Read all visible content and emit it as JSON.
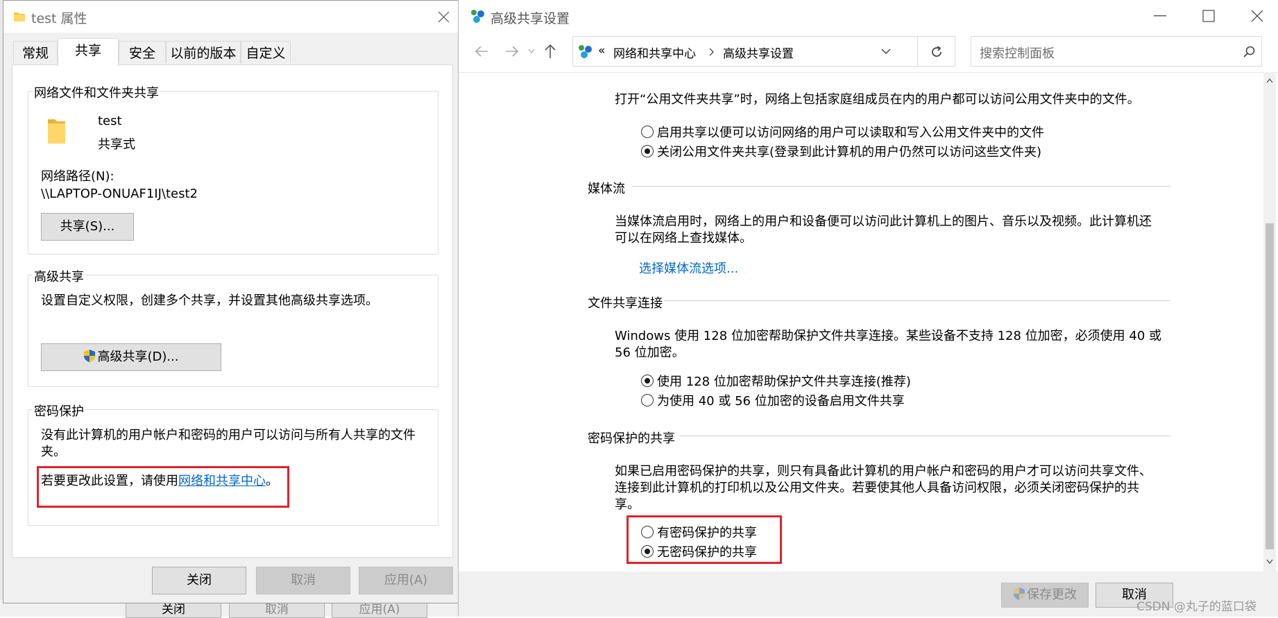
{
  "props": {
    "title": "test 属性",
    "tabs": [
      "常规",
      "共享",
      "安全",
      "以前的版本",
      "自定义"
    ],
    "group1": {
      "title": "网络文件和文件夹共享",
      "folder_name": "test",
      "share_state": "共享式",
      "path_label": "网络路径(N):",
      "path_value": "\\\\LAPTOP-ONUAF1IJ\\test2",
      "share_button": "共享(S)..."
    },
    "group2": {
      "title": "高级共享",
      "desc": "设置自定义权限，创建多个共享，并设置其他高级共享选项。",
      "button": "高级共享(D)..."
    },
    "group3": {
      "title": "密码保护",
      "desc_line1": "没有此计算机的用户帐户和密码的用户可以访问与所有人共享的文件",
      "desc_line2": "夹。",
      "change_prefix": "若要更改此设置，请使用",
      "change_link": "网络和共享中心",
      "change_suffix": "。"
    },
    "buttons": {
      "close": "关闭",
      "cancel": "取消",
      "apply": "应用(A)"
    }
  },
  "background_buttons": {
    "close": "关闭",
    "cancel": "取消",
    "apply": "应用(A)"
  },
  "window": {
    "title": "高级共享设置",
    "breadcrumb_prefix": "«",
    "breadcrumb": [
      "网络和共享中心",
      "高级共享设置"
    ],
    "search_placeholder": "搜索控制面板",
    "public": {
      "desc": "打开“公用文件夹共享”时，网络上包括家庭组成员在内的用户都可以访问公用文件夹中的文件。",
      "opt1": "启用共享以便可以访问网络的用户可以读取和写入公用文件夹中的文件",
      "opt2": "关闭公用文件夹共享(登录到此计算机的用户仍然可以访问这些文件夹)"
    },
    "media": {
      "heading": "媒体流",
      "desc_line1": "当媒体流启用时，网络上的用户和设备便可以访问此计算机上的图片、音乐以及视频。此计算机还",
      "desc_line2": "可以在网络上查找媒体。",
      "link": "选择媒体流选项..."
    },
    "file_sharing": {
      "heading": "文件共享连接",
      "desc_line1": "Windows 使用 128 位加密帮助保护文件共享连接。某些设备不支持 128 位加密，必须使用 40 或",
      "desc_line2": "56 位加密。",
      "opt1": "使用 128 位加密帮助保护文件共享连接(推荐)",
      "opt2": "为使用 40 或 56 位加密的设备启用文件共享"
    },
    "password": {
      "heading": "密码保护的共享",
      "desc_line1": "如果已启用密码保护的共享，则只有具备此计算机的用户帐户和密码的用户才可以访问共享文件、",
      "desc_line2": "连接到此计算机的打印机以及公用文件夹。若要使其他人具备访问权限，必须关闭密码保护的共",
      "desc_line3": "享。",
      "opt1": "有密码保护的共享",
      "opt2": "无密码保护的共享"
    },
    "footer": {
      "save": "保存更改",
      "cancel": "取消"
    }
  },
  "watermark": "CSDN @丸子的蓝口袋",
  "colors": {
    "highlight": "#e0222a",
    "link": "#0066cc",
    "folder": "#f4c542"
  }
}
